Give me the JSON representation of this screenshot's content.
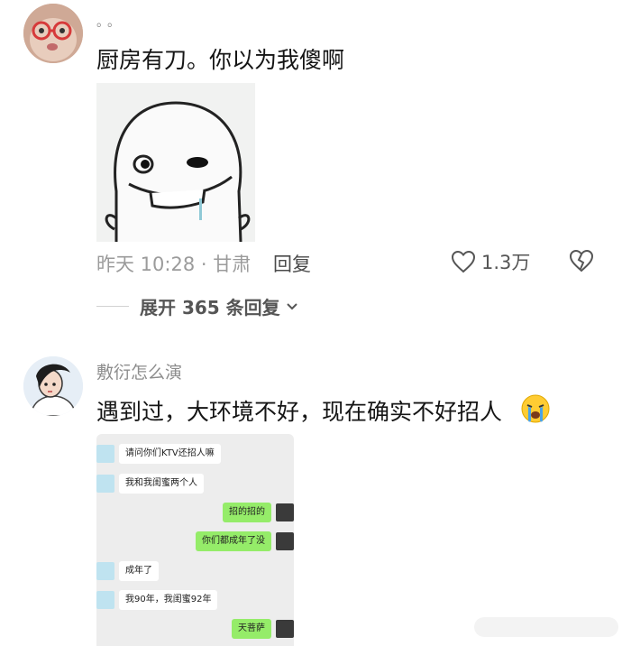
{
  "comments": [
    {
      "username": "。。",
      "text": "厨房有刀。你以为我傻啊",
      "meta": "昨天 10:28 · 甘肃",
      "reply_label": "回复",
      "likes": "1.3万",
      "expand_label": "展开 365 条回复"
    },
    {
      "username": "敷衍怎么演",
      "text": "遇到过，大环境不好，现在确实不好招人"
    }
  ],
  "chat": [
    {
      "side": "left",
      "text": "请问你们KTV还招人嘛"
    },
    {
      "side": "left",
      "text": "我和我闺蜜两个人"
    },
    {
      "side": "right",
      "text": "招的招的"
    },
    {
      "side": "right",
      "text": "你们都成年了没"
    },
    {
      "side": "left",
      "text": "成年了"
    },
    {
      "side": "left",
      "text": "我90年，我闺蜜92年"
    },
    {
      "side": "right",
      "text": "天菩萨"
    }
  ],
  "colors": {
    "accent_green": "#95ec69",
    "meta_gray": "#9b9b9b"
  },
  "icons": [
    "heart-icon",
    "broken-heart-icon",
    "chevron-down-icon",
    "crying-emoji-icon"
  ]
}
